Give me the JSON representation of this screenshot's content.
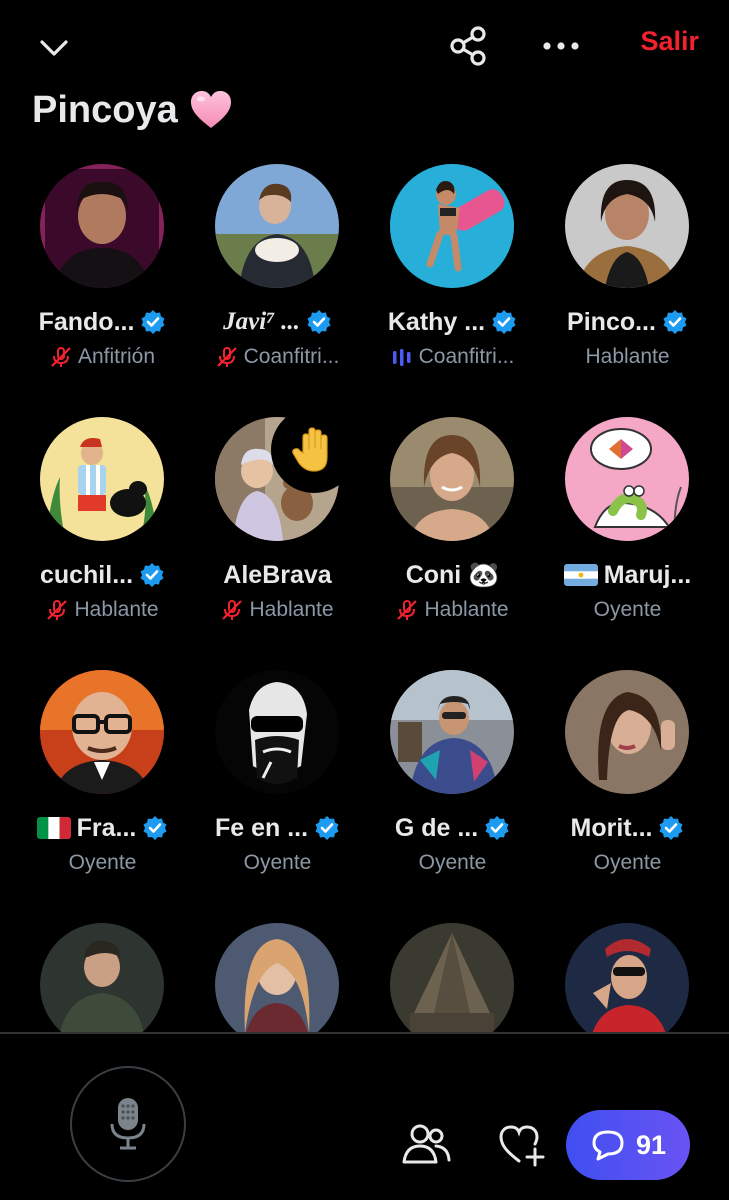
{
  "header": {
    "collapse_icon": "chevron-down-icon",
    "share_icon": "share-icon",
    "more_icon": "more-horizontal-icon",
    "leave_label": "Salir",
    "title": "Pincoya",
    "title_emoji": "pink-heart-icon"
  },
  "colors": {
    "background": "#000000",
    "leave": "#f4212e",
    "verified": "#1d9bf0",
    "muted": "#f4212e",
    "speaking": "#4a5cf5",
    "secondary_text": "#8b98a5",
    "comments_pill": "#4f50f2"
  },
  "participants": [
    {
      "name": "Fando...",
      "verified": true,
      "role": "Anfitrión",
      "status": "muted"
    },
    {
      "name": "Javi⁷ ...",
      "verified": true,
      "role": "Coanfitri...",
      "status": "muted"
    },
    {
      "name": "Kathy ...",
      "verified": true,
      "role": "Coanfitri...",
      "status": "speaking"
    },
    {
      "name": "Pinco...",
      "verified": true,
      "role": "Hablante",
      "status": "none"
    },
    {
      "name": "cuchil...",
      "verified": true,
      "role": "Hablante",
      "status": "muted"
    },
    {
      "name": "AleBrava",
      "verified": false,
      "role": "Hablante",
      "status": "muted",
      "raised_hand": true
    },
    {
      "name": "Coni 🐼",
      "verified": false,
      "role": "Hablante",
      "status": "muted"
    },
    {
      "name": "Maruj...",
      "verified": false,
      "role": "Oyente",
      "status": "none",
      "flag": "argentina-flag-icon"
    },
    {
      "name": "Fra...",
      "verified": true,
      "role": "Oyente",
      "status": "none",
      "flag": "italy-flag-icon"
    },
    {
      "name": "Fe en ...",
      "verified": true,
      "role": "Oyente",
      "status": "none"
    },
    {
      "name": "G de ...",
      "verified": true,
      "role": "Oyente",
      "status": "none"
    },
    {
      "name": "Morit...",
      "verified": true,
      "role": "Oyente",
      "status": "none"
    },
    {
      "name": "",
      "verified": false,
      "role": "",
      "status": "none"
    },
    {
      "name": "",
      "verified": false,
      "role": "",
      "status": "none"
    },
    {
      "name": "",
      "verified": false,
      "role": "",
      "status": "none"
    },
    {
      "name": "",
      "verified": false,
      "role": "",
      "status": "none"
    }
  ],
  "footer": {
    "mic_icon": "microphone-icon",
    "people_icon": "people-icon",
    "heart_plus_icon": "heart-plus-icon",
    "comments_icon": "comment-bubble-icon",
    "comments_count": "91"
  }
}
